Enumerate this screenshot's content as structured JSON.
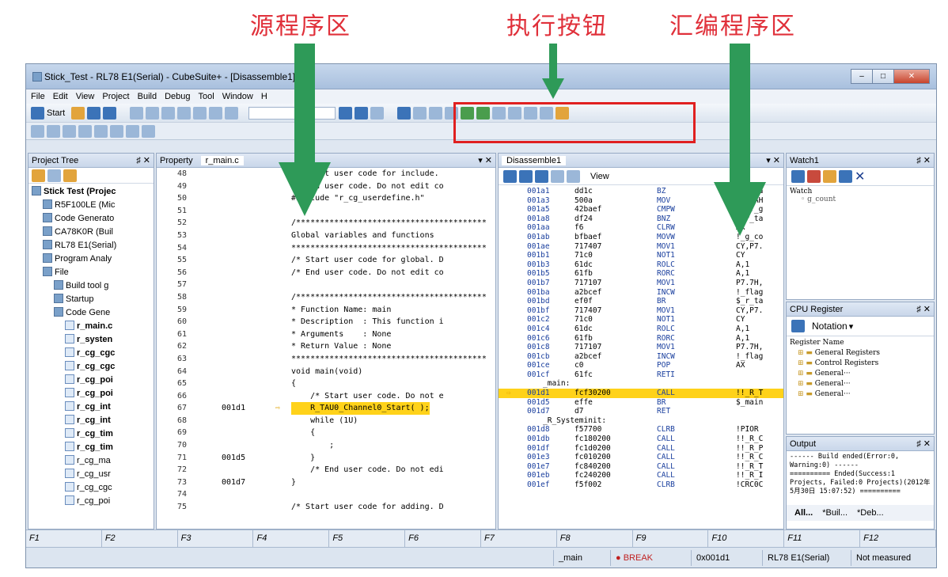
{
  "annotations": {
    "source_area": "源程序区",
    "exec_buttons": "执行按钮",
    "disasm_area": "汇编程序区"
  },
  "window": {
    "title": "Stick_Test - RL78 E1(Serial) - CubeSuite+ - [Disassemble1]"
  },
  "menu": [
    "File",
    "Edit",
    "View",
    "Project",
    "Build",
    "Debug",
    "Tool",
    "Window",
    "H"
  ],
  "toolbar": {
    "start": "Start"
  },
  "project_tree": {
    "title": "Project Tree",
    "items": [
      {
        "label": "Stick Test (Projec",
        "indent": 0,
        "bold": true
      },
      {
        "label": "R5F100LE (Mic",
        "indent": 1
      },
      {
        "label": "Code Generato",
        "indent": 1
      },
      {
        "label": "CA78K0R (Buil",
        "indent": 1
      },
      {
        "label": "RL78 E1(Serial)",
        "indent": 1
      },
      {
        "label": "Program Analy",
        "indent": 1
      },
      {
        "label": "File",
        "indent": 1
      },
      {
        "label": "Build tool g",
        "indent": 2
      },
      {
        "label": "Startup",
        "indent": 2
      },
      {
        "label": "Code Gene",
        "indent": 2
      },
      {
        "label": "r_main.c",
        "indent": 3,
        "bold": true
      },
      {
        "label": "r_systen",
        "indent": 3,
        "bold": true
      },
      {
        "label": "r_cg_cgc",
        "indent": 3,
        "bold": true
      },
      {
        "label": "r_cg_cgc",
        "indent": 3,
        "bold": true
      },
      {
        "label": "r_cg_poi",
        "indent": 3,
        "bold": true
      },
      {
        "label": "r_cg_poi",
        "indent": 3,
        "bold": true
      },
      {
        "label": "r_cg_int",
        "indent": 3,
        "bold": true
      },
      {
        "label": "r_cg_int",
        "indent": 3,
        "bold": true
      },
      {
        "label": "r_cg_tim",
        "indent": 3,
        "bold": true
      },
      {
        "label": "r_cg_tim",
        "indent": 3,
        "bold": true
      },
      {
        "label": "r_cg_ma",
        "indent": 3
      },
      {
        "label": "r_cg_usr",
        "indent": 3
      },
      {
        "label": "r_cg_cgc",
        "indent": 3
      },
      {
        "label": "r_cg_poi",
        "indent": 3
      }
    ]
  },
  "editor": {
    "tabs": [
      "Property",
      "r_main.c"
    ],
    "lines": [
      {
        "n": "48",
        "addr": "",
        "text": "/* Start user code for include. "
      },
      {
        "n": "49",
        "addr": "",
        "text": "/* End user code. Do not edit co"
      },
      {
        "n": "50",
        "addr": "",
        "text": "#include \"r_cg_userdefine.h\""
      },
      {
        "n": "51",
        "addr": "",
        "text": ""
      },
      {
        "n": "52",
        "addr": "",
        "text": "/****************************************"
      },
      {
        "n": "53",
        "addr": "",
        "text": "Global variables and functions"
      },
      {
        "n": "54",
        "addr": "",
        "text": "*****************************************"
      },
      {
        "n": "55",
        "addr": "",
        "text": "/* Start user code for global. D"
      },
      {
        "n": "56",
        "addr": "",
        "text": "/* End user code. Do not edit co"
      },
      {
        "n": "57",
        "addr": "",
        "text": ""
      },
      {
        "n": "58",
        "addr": "",
        "text": "/****************************************"
      },
      {
        "n": "59",
        "addr": "",
        "text": "* Function Name: main"
      },
      {
        "n": "60",
        "addr": "",
        "text": "* Description  : This function i"
      },
      {
        "n": "61",
        "addr": "",
        "text": "* Arguments    : None"
      },
      {
        "n": "62",
        "addr": "",
        "text": "* Return Value : None"
      },
      {
        "n": "63",
        "addr": "",
        "text": "*****************************************"
      },
      {
        "n": "64",
        "addr": "",
        "text": "void main(void)"
      },
      {
        "n": "65",
        "addr": "",
        "text": "{"
      },
      {
        "n": "66",
        "addr": "",
        "text": "    /* Start user code. Do not e"
      },
      {
        "n": "67",
        "addr": "001d1",
        "text": "    R_TAU0_Channel0_Start( );"
      },
      {
        "n": "68",
        "addr": "",
        "text": "    while (1U)"
      },
      {
        "n": "69",
        "addr": "",
        "text": "    {"
      },
      {
        "n": "70",
        "addr": "",
        "text": "        ;"
      },
      {
        "n": "71",
        "addr": "001d5",
        "text": "    }"
      },
      {
        "n": "72",
        "addr": "",
        "text": "    /* End user code. Do not edi"
      },
      {
        "n": "73",
        "addr": "001d7",
        "text": "}"
      },
      {
        "n": "74",
        "addr": "",
        "text": ""
      },
      {
        "n": "75",
        "addr": "",
        "text": "/* Start user code for adding. D"
      }
    ]
  },
  "disasm": {
    "tab": "Disassemble1",
    "view_label": "View",
    "rows": [
      {
        "a": "001a1",
        "h": "dd1c",
        "m": "BZ",
        "o": "$_r_ta"
      },
      {
        "a": "001a3",
        "h": "500a",
        "m": "MOV",
        "o": "X,#0AH"
      },
      {
        "a": "001a5",
        "h": "42baef",
        "m": "CMPW",
        "o": "AX,!_g"
      },
      {
        "a": "001a8",
        "h": "df24",
        "m": "BNZ",
        "o": "$_r_ta"
      },
      {
        "a": "001aa",
        "h": "f6",
        "m": "CLRW",
        "o": "AX"
      },
      {
        "a": "001ab",
        "h": "bfbaef",
        "m": "MOVW",
        "o": "!_g_co"
      },
      {
        "a": "001ae",
        "h": "717407",
        "m": "MOV1",
        "o": "CY,P7."
      },
      {
        "a": "001b1",
        "h": "71c0",
        "m": "NOT1",
        "o": "CY"
      },
      {
        "a": "001b3",
        "h": "61dc",
        "m": "ROLC",
        "o": "A,1"
      },
      {
        "a": "001b5",
        "h": "61fb",
        "m": "RORC",
        "o": "A,1"
      },
      {
        "a": "001b7",
        "h": "717107",
        "m": "MOV1",
        "o": "P7.7H,"
      },
      {
        "a": "001ba",
        "h": "a2bcef",
        "m": "INCW",
        "o": "!_flag"
      },
      {
        "a": "001bd",
        "h": "ef0f",
        "m": "BR",
        "o": "$_r_ta"
      },
      {
        "a": "001bf",
        "h": "717407",
        "m": "MOV1",
        "o": "CY,P7."
      },
      {
        "a": "001c2",
        "h": "71c0",
        "m": "NOT1",
        "o": "CY"
      },
      {
        "a": "001c4",
        "h": "61dc",
        "m": "ROLC",
        "o": "A,1"
      },
      {
        "a": "001c6",
        "h": "61fb",
        "m": "RORC",
        "o": "A,1"
      },
      {
        "a": "001c8",
        "h": "717107",
        "m": "MOV1",
        "o": "P7.7H,"
      },
      {
        "a": "001cb",
        "h": "a2bcef",
        "m": "INCW",
        "o": "!_flag"
      },
      {
        "a": "001ce",
        "h": "c0",
        "m": "POP",
        "o": "AX"
      },
      {
        "a": "001cf",
        "h": "61fc",
        "m": "RETI",
        "o": ""
      },
      {
        "label": "_main:"
      },
      {
        "a": "001d1",
        "h": "fcf30200",
        "m": "CALL",
        "o": "!!_R_T",
        "hl": true
      },
      {
        "a": "001d5",
        "h": "effe",
        "m": "BR",
        "o": "$_main"
      },
      {
        "a": "001d7",
        "h": "d7",
        "m": "RET",
        "o": ""
      },
      {
        "label": "_R_Systeminit:"
      },
      {
        "a": "001d8",
        "h": "f57700",
        "m": "CLRB",
        "o": "!PIOR"
      },
      {
        "a": "001db",
        "h": "fc180200",
        "m": "CALL",
        "o": "!!_R_C"
      },
      {
        "a": "001df",
        "h": "fc1d0200",
        "m": "CALL",
        "o": "!!_R_P"
      },
      {
        "a": "001e3",
        "h": "fc010200",
        "m": "CALL",
        "o": "!!_R_C"
      },
      {
        "a": "001e7",
        "h": "fc840200",
        "m": "CALL",
        "o": "!!_R_T"
      },
      {
        "a": "001eb",
        "h": "fc240200",
        "m": "CALL",
        "o": "!!_R_I"
      },
      {
        "a": "001ef",
        "h": "f5f002",
        "m": "CLRB",
        "o": "!CRC0C"
      }
    ]
  },
  "watch": {
    "title": "Watch1",
    "col": "Watch",
    "item": "g_count"
  },
  "cpu": {
    "title": "CPU Register",
    "notation": "Notation",
    "col": "Register Name",
    "items": [
      "General Registers",
      "Control Registers",
      "General···",
      "General···",
      "General···"
    ]
  },
  "output": {
    "title": "Output",
    "text": "------ Build ended(Error:0, Warning:0) ------\n========== Ended(Success:1 Projects, Failed:0 Projects)(2012年5月30日 15:07:52) ==========",
    "tabs": [
      "All...",
      "*Buil...",
      "*Deb..."
    ]
  },
  "fkeys": [
    "F1",
    "F2",
    "F3",
    "F4",
    "F5",
    "F6",
    "F7",
    "F8",
    "F9",
    "F10",
    "F11",
    "F12"
  ],
  "status": {
    "func": "_main",
    "state": "BREAK",
    "pc": "0x001d1",
    "target": "RL78 E1(Serial)",
    "measure": "Not measured"
  }
}
